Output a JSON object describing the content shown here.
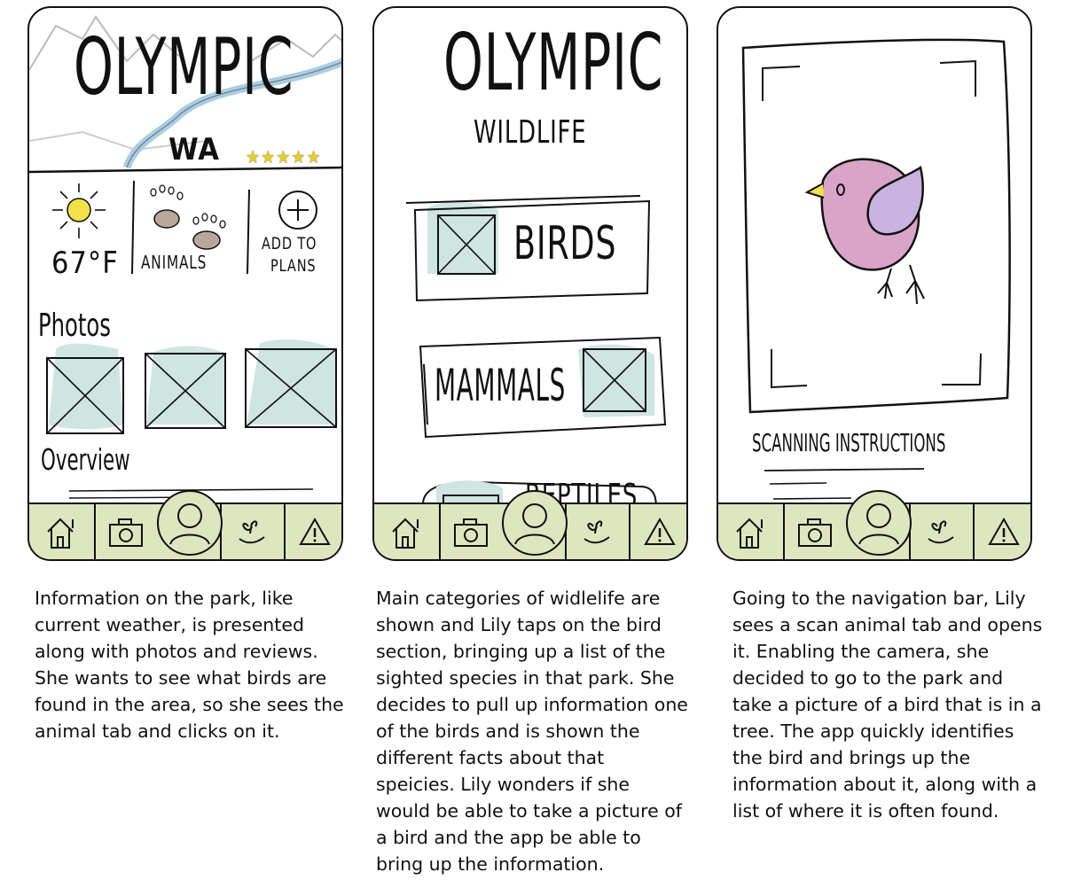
{
  "panels": [
    {
      "title": "OLYMPIC",
      "state": "WA",
      "temperature": "67°F",
      "animals_label": "ANIMALS",
      "add_plans_line1": "ADD TO",
      "add_plans_line2": "PLANS",
      "photos_label": "Photos",
      "overview_label": "Overview",
      "caption": "Information on the park, like current weather, is presented along with photos and reviews. She wants to see what birds are found in the area, so she sees the animal tab and clicks on it."
    },
    {
      "title": "OLYMPIC",
      "subtitle": "WILDLIFE",
      "birds_label": "BIRDS",
      "mammals_label": "MAMMALS",
      "reptiles_label": "REPTILES",
      "caption": "Main categories of widlelife are shown and Lily taps on the bird section, bringing up a list of the sighted species in that park. She decides to pull up information one of the birds and is shown the different facts about that speicies. Lily wonders if she would be able to take a picture of a bird and the app be able to bring up the information."
    },
    {
      "scan_label": "SCANNING INSTRUCTIONS",
      "caption": "Going to the navigation bar, Lily sees a scan animal tab and opens it. Enabling the camera, she decided to go to the park and take a picture of a bird that is in a tree. The app quickly identifies the bird and brings up the information about it, along with a list of where it is often found."
    }
  ],
  "navbar": {
    "icons": [
      "home-icon",
      "camera-icon",
      "profile-icon",
      "plant-icon",
      "alert-icon"
    ],
    "background": "#dde6bf"
  },
  "colors": {
    "placeholder_fill": "#cfe5e2",
    "sun": "#f2e24a",
    "bird_body": "#d9a4c8",
    "bird_wing": "#c9b3e0",
    "river": "#a8cde6"
  },
  "rating_stars": 5
}
